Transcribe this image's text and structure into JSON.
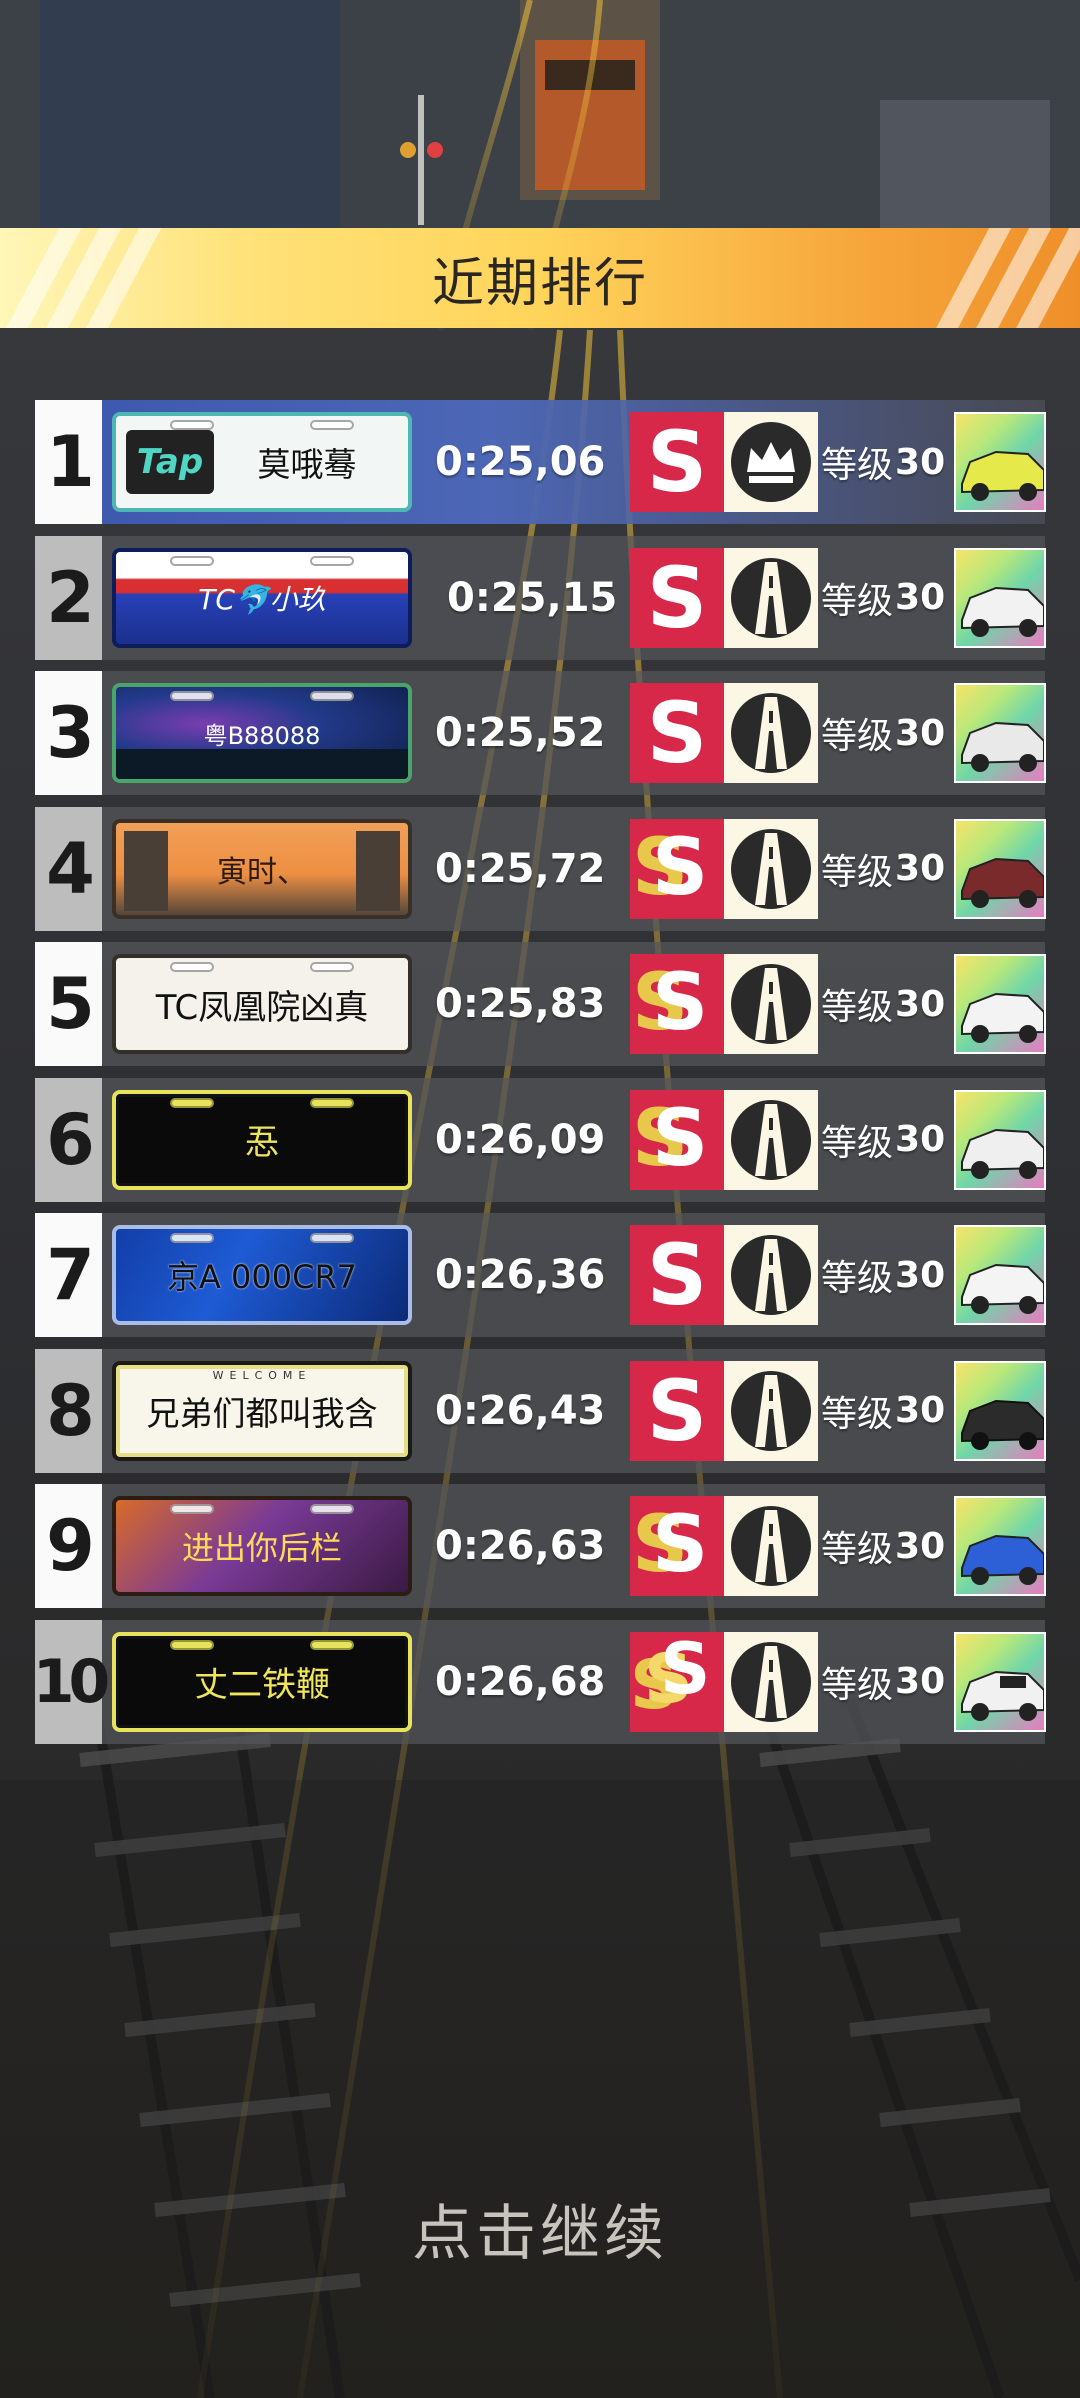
{
  "header": {
    "title": "近期排行"
  },
  "leaderboard": [
    {
      "rank": "1",
      "plate": "莫哦蓦",
      "plate_logo": "Tap",
      "time": "0:25,06",
      "grade": "S",
      "track_icon": "crown-icon",
      "level_label": "等级",
      "level": "30",
      "car_color": "#e6e94a"
    },
    {
      "rank": "2",
      "plate": "TC🐬小玖",
      "time": "0:25,15",
      "grade": "S",
      "track_icon": "road-icon",
      "level_label": "等级",
      "level": "30",
      "car_color": "#f2f2f2"
    },
    {
      "rank": "3",
      "plate": "粤B88088",
      "time": "0:25,52",
      "grade": "S",
      "track_icon": "road-icon",
      "level_label": "等级",
      "level": "30",
      "car_color": "#e9e9e9"
    },
    {
      "rank": "4",
      "plate": "寅时、",
      "time": "0:25,72",
      "grade": "SS",
      "track_icon": "road-icon",
      "level_label": "等级",
      "level": "30",
      "car_color": "#7a2a2a"
    },
    {
      "rank": "5",
      "plate": "TC凤凰院凶真",
      "time": "0:25,83",
      "grade": "SS",
      "track_icon": "road-icon",
      "level_label": "等级",
      "level": "30",
      "car_color": "#f3f3f3"
    },
    {
      "rank": "6",
      "plate": "忢",
      "time": "0:26,09",
      "grade": "SS",
      "track_icon": "road-icon",
      "level_label": "等级",
      "level": "30",
      "car_color": "#efefef"
    },
    {
      "rank": "7",
      "plate": "京A 000CR7",
      "time": "0:26,36",
      "grade": "S",
      "track_icon": "road-icon",
      "level_label": "等级",
      "level": "30",
      "car_color": "#f4f4f4"
    },
    {
      "rank": "8",
      "plate": "兄弟们都叫我含",
      "plate_top": "WELCOME",
      "time": "0:26,43",
      "grade": "S",
      "track_icon": "road-icon",
      "level_label": "等级",
      "level": "30",
      "car_color": "#2b2b2b"
    },
    {
      "rank": "9",
      "plate": "进出你后栏",
      "time": "0:26,63",
      "grade": "SS",
      "track_icon": "road-icon",
      "level_label": "等级",
      "level": "30",
      "car_color": "#2d5fd6"
    },
    {
      "rank": "10",
      "plate": "丈二铁鞭",
      "time": "0:26,68",
      "grade": "SSS",
      "track_icon": "road-icon",
      "level_label": "等级",
      "level": "30",
      "car_color": "#f1f1f1"
    }
  ],
  "footer": {
    "continue_label": "点击继续"
  },
  "colors": {
    "grade_red": "#d8284a",
    "gold": "#e8c84a",
    "banner_orange": "#f2a23a"
  }
}
